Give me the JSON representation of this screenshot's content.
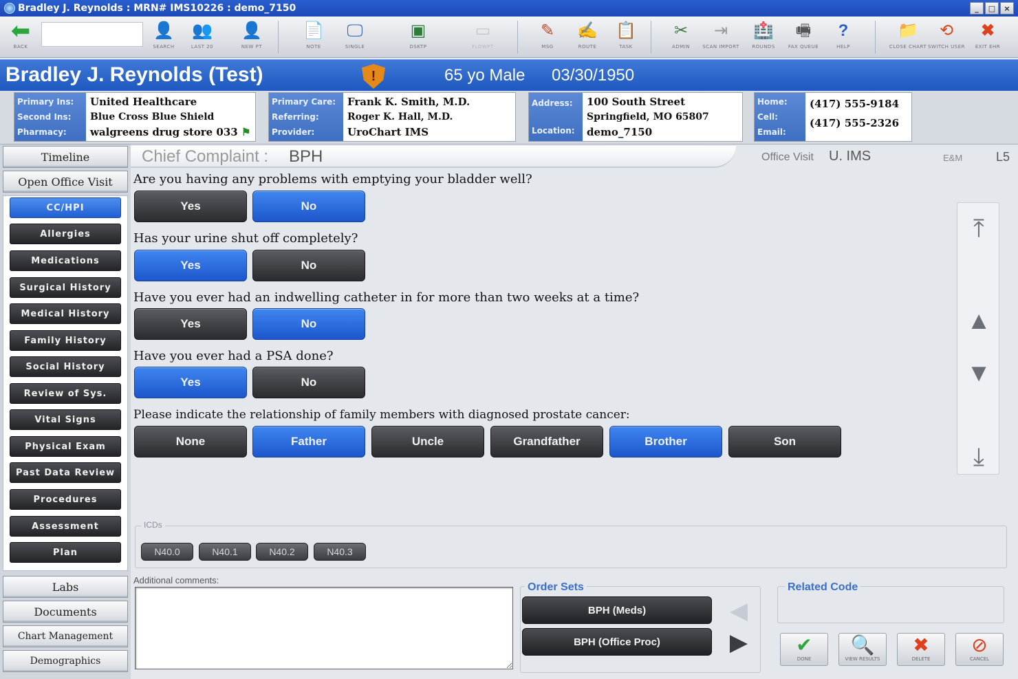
{
  "window": {
    "title": "Bradley J. Reynolds : MRN# IMS10226 : demo_7150"
  },
  "toolbar": {
    "buttons": [
      {
        "label": "BACK",
        "icon": "back-arrow"
      },
      {
        "label": "SEARCH",
        "icon": "search-person"
      },
      {
        "label": "LAST 20",
        "icon": "recent-patients"
      },
      {
        "label": "NEW PT",
        "icon": "new-patient"
      },
      {
        "label": "NOTE",
        "icon": "note"
      },
      {
        "label": "SINGLE",
        "icon": "single-monitor"
      },
      {
        "label": "DSKTP",
        "icon": "desktop"
      },
      {
        "label": "FLOWPT",
        "icon": "flow"
      },
      {
        "label": "MSG",
        "icon": "message"
      },
      {
        "label": "ROUTE",
        "icon": "route"
      },
      {
        "label": "TASK",
        "icon": "task"
      },
      {
        "label": "ADMIN",
        "icon": "admin-tools"
      },
      {
        "label": "SCAN IMPORT",
        "icon": "scan-import"
      },
      {
        "label": "ROUNDS",
        "icon": "rounds"
      },
      {
        "label": "FAX QUEUE",
        "icon": "fax-queue"
      },
      {
        "label": "HELP",
        "icon": "help"
      },
      {
        "label": "CLOSE CHART",
        "icon": "close-chart"
      },
      {
        "label": "SWITCH USER",
        "icon": "switch-user"
      },
      {
        "label": "EXIT EHR",
        "icon": "exit"
      }
    ]
  },
  "patient": {
    "name": "Bradley J. Reynolds (Test)",
    "demographics": "65 yo Male",
    "dob": "03/30/1950",
    "alert_icon": "!"
  },
  "insurance": {
    "keys": [
      "Primary Ins:",
      "Second Ins:",
      "Pharmacy:"
    ],
    "primary": "United Healthcare",
    "secondary": "Blue Cross Blue Shield",
    "pharmacy": "walgreens drug store 033"
  },
  "care": {
    "keys": [
      "Primary Care:",
      "Referring:",
      "Provider:"
    ],
    "primary": "Frank K. Smith, M.D.",
    "referring": "Roger K. Hall, M.D.",
    "provider": "UroChart IMS"
  },
  "address": {
    "keys": [
      "Address:",
      "",
      "Location:"
    ],
    "line1": "100 South Street",
    "line2": "Springfield, MO 65807",
    "location": "demo_7150"
  },
  "contact": {
    "keys": [
      "Home:",
      "Cell:",
      "Email:"
    ],
    "home": "(417) 555-9184",
    "cell": "(417) 555-2326",
    "email": ""
  },
  "nav": {
    "timeline": "Timeline",
    "open_visit": "Open Office Visit",
    "sections": [
      "CC/HPI",
      "Allergies",
      "Medications",
      "Surgical History",
      "Medical History",
      "Family History",
      "Social History",
      "Review of Sys.",
      "Vital Signs",
      "Physical Exam",
      "Past Data Review",
      "Procedures",
      "Assessment",
      "Plan"
    ],
    "labs": "Labs",
    "documents": "Documents",
    "chart_management": "Chart Management",
    "demographics": "Demographics"
  },
  "main": {
    "cc_label": "Chief Complaint :",
    "cc_value": "BPH",
    "visit_type": "Office Visit",
    "provider_short": "U. IMS",
    "em_label": "E&M",
    "level": "L5"
  },
  "questions": [
    {
      "text": "Are you having any problems with emptying your bladder well?",
      "options": [
        "Yes",
        "No"
      ],
      "selected": [
        "No"
      ]
    },
    {
      "text": "Has your urine shut off completely?",
      "options": [
        "Yes",
        "No"
      ],
      "selected": [
        "Yes"
      ]
    },
    {
      "text": "Have you ever had an indwelling catheter in for more than two weeks at a time?",
      "options": [
        "Yes",
        "No"
      ],
      "selected": [
        "No"
      ]
    },
    {
      "text": "Have you ever had a PSA done?",
      "options": [
        "Yes",
        "No"
      ],
      "selected": [
        "Yes"
      ]
    },
    {
      "text": "Please indicate the relationship of family members with diagnosed prostate cancer:",
      "options": [
        "None",
        "Father",
        "Uncle",
        "Grandfather",
        "Brother",
        "Son"
      ],
      "selected": [
        "Father",
        "Brother"
      ]
    }
  ],
  "icds": {
    "legend": "ICDs",
    "codes": [
      "N40.0",
      "N40.1",
      "N40.2",
      "N40.3"
    ]
  },
  "comments": {
    "label": "Additional comments:",
    "value": ""
  },
  "order_sets": {
    "legend": "Order Sets",
    "items": [
      "BPH (Meds)",
      "BPH (Office Proc)"
    ]
  },
  "related_code": {
    "legend": "Related Code"
  },
  "actions": [
    {
      "label": "DONE",
      "icon": "check"
    },
    {
      "label": "VIEW RESULTS",
      "icon": "view-results"
    },
    {
      "label": "DELETE",
      "icon": "delete"
    },
    {
      "label": "CANCEL",
      "icon": "cancel"
    }
  ],
  "colors": {
    "selected": "#1f5fd2",
    "unselected": "#2a2b2e",
    "banner": "#2b63c8"
  }
}
